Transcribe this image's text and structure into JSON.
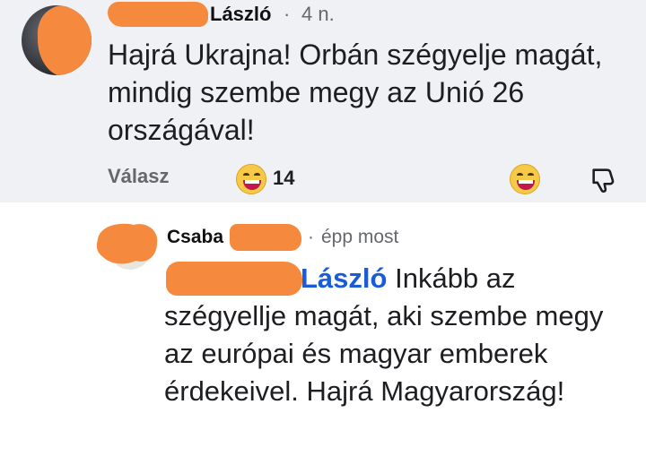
{
  "comment": {
    "author_visible": "László",
    "separator": "·",
    "time": "4 n.",
    "text": "Hajrá Ukrajna! Orbán szégyelje magát, mindig szembe megy az Unió 26 országával!",
    "reply_label": "Válasz",
    "reaction_count": "14",
    "reaction_icon": "laughing-face-icon",
    "react_button_icon": "laughing-face-icon",
    "dislike_icon": "thumbs-down-icon"
  },
  "reply": {
    "author_visible": "Csaba",
    "separator": "·",
    "time": "épp most",
    "mention_visible": "László",
    "text": "Inkább az szégyellje magát, aki szembe megy az európai és magyar emberek érdekeivel. Hajrá Magyarország!"
  },
  "colors": {
    "redaction": "#f5893d",
    "mention": "#1a5bd8",
    "top_background": "#f0f1f4"
  }
}
